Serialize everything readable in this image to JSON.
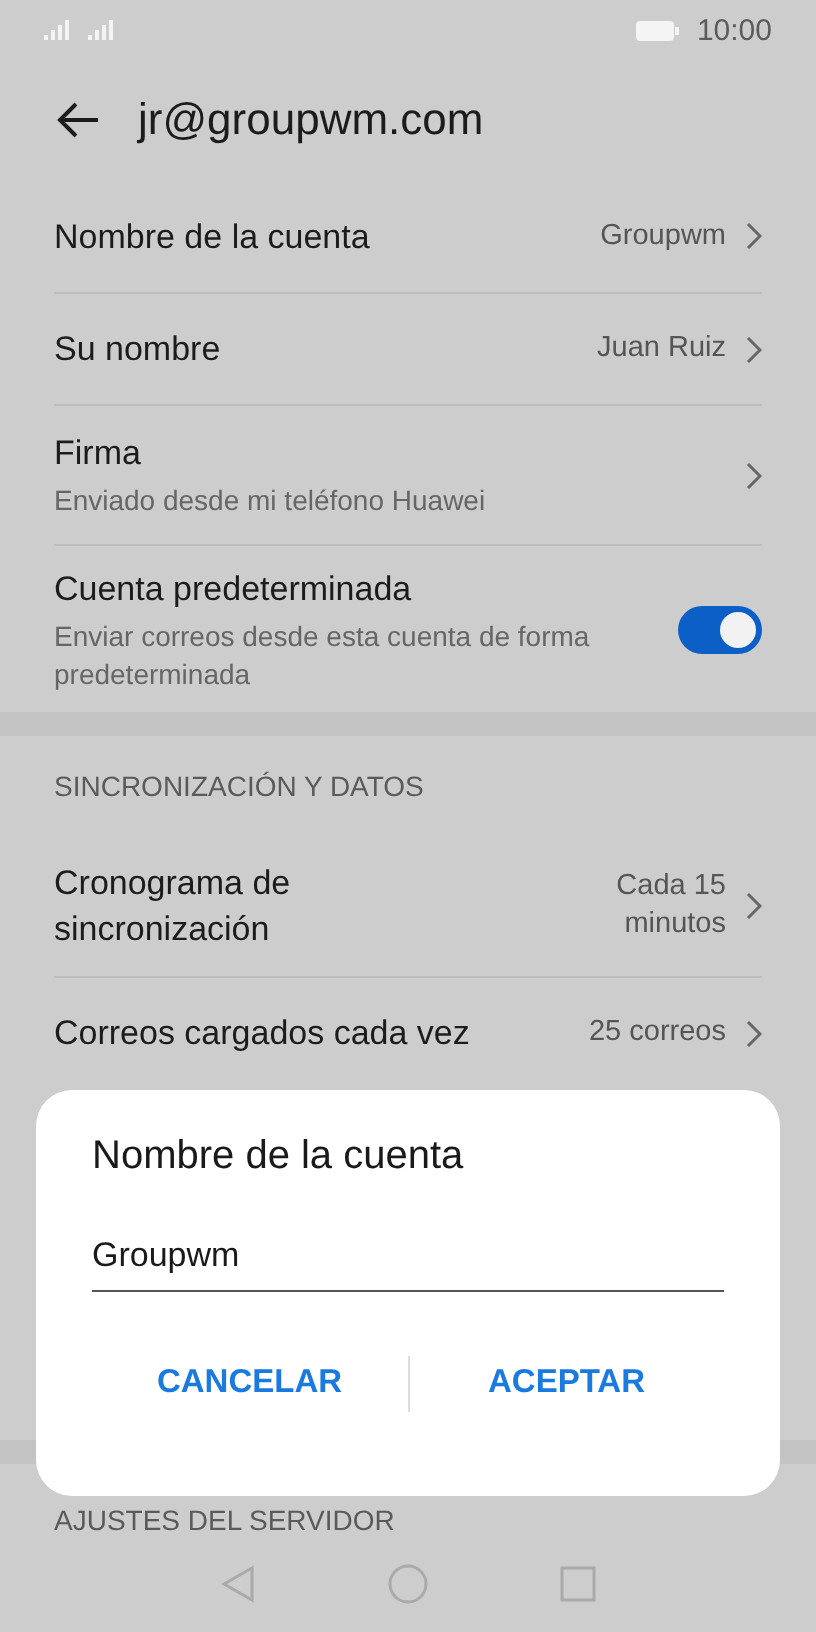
{
  "status_bar": {
    "time": "10:00"
  },
  "header": {
    "title": "jr@groupwm.com"
  },
  "sections": [
    {
      "items": [
        {
          "kind": "value",
          "label": "Nombre de la cuenta",
          "value": "Groupwm"
        },
        {
          "kind": "value",
          "label": "Su nombre",
          "value": "Juan Ruiz"
        },
        {
          "kind": "subtitle",
          "label": "Firma",
          "subtitle": "Enviado desde mi teléfono Huawei"
        },
        {
          "kind": "toggle",
          "label": "Cuenta predeterminada",
          "subtitle": "Enviar correos desde esta cuenta de forma predeterminada",
          "on": true
        }
      ]
    },
    {
      "title": "SINCRONIZACIÓN Y DATOS",
      "items": [
        {
          "kind": "value",
          "label": "Cronograma de sincronización",
          "value": "Cada 15 minutos"
        },
        {
          "kind": "value",
          "label": "Correos cargados cada vez",
          "value": "25 correos"
        }
      ]
    },
    {
      "title": "AJUSTES DEL SERVIDOR"
    }
  ],
  "dialog": {
    "title": "Nombre de la cuenta",
    "field": {
      "value": "Groupwm"
    },
    "buttons": [
      {
        "label": "CANCELAR"
      },
      {
        "label": "ACEPTAR"
      }
    ]
  }
}
